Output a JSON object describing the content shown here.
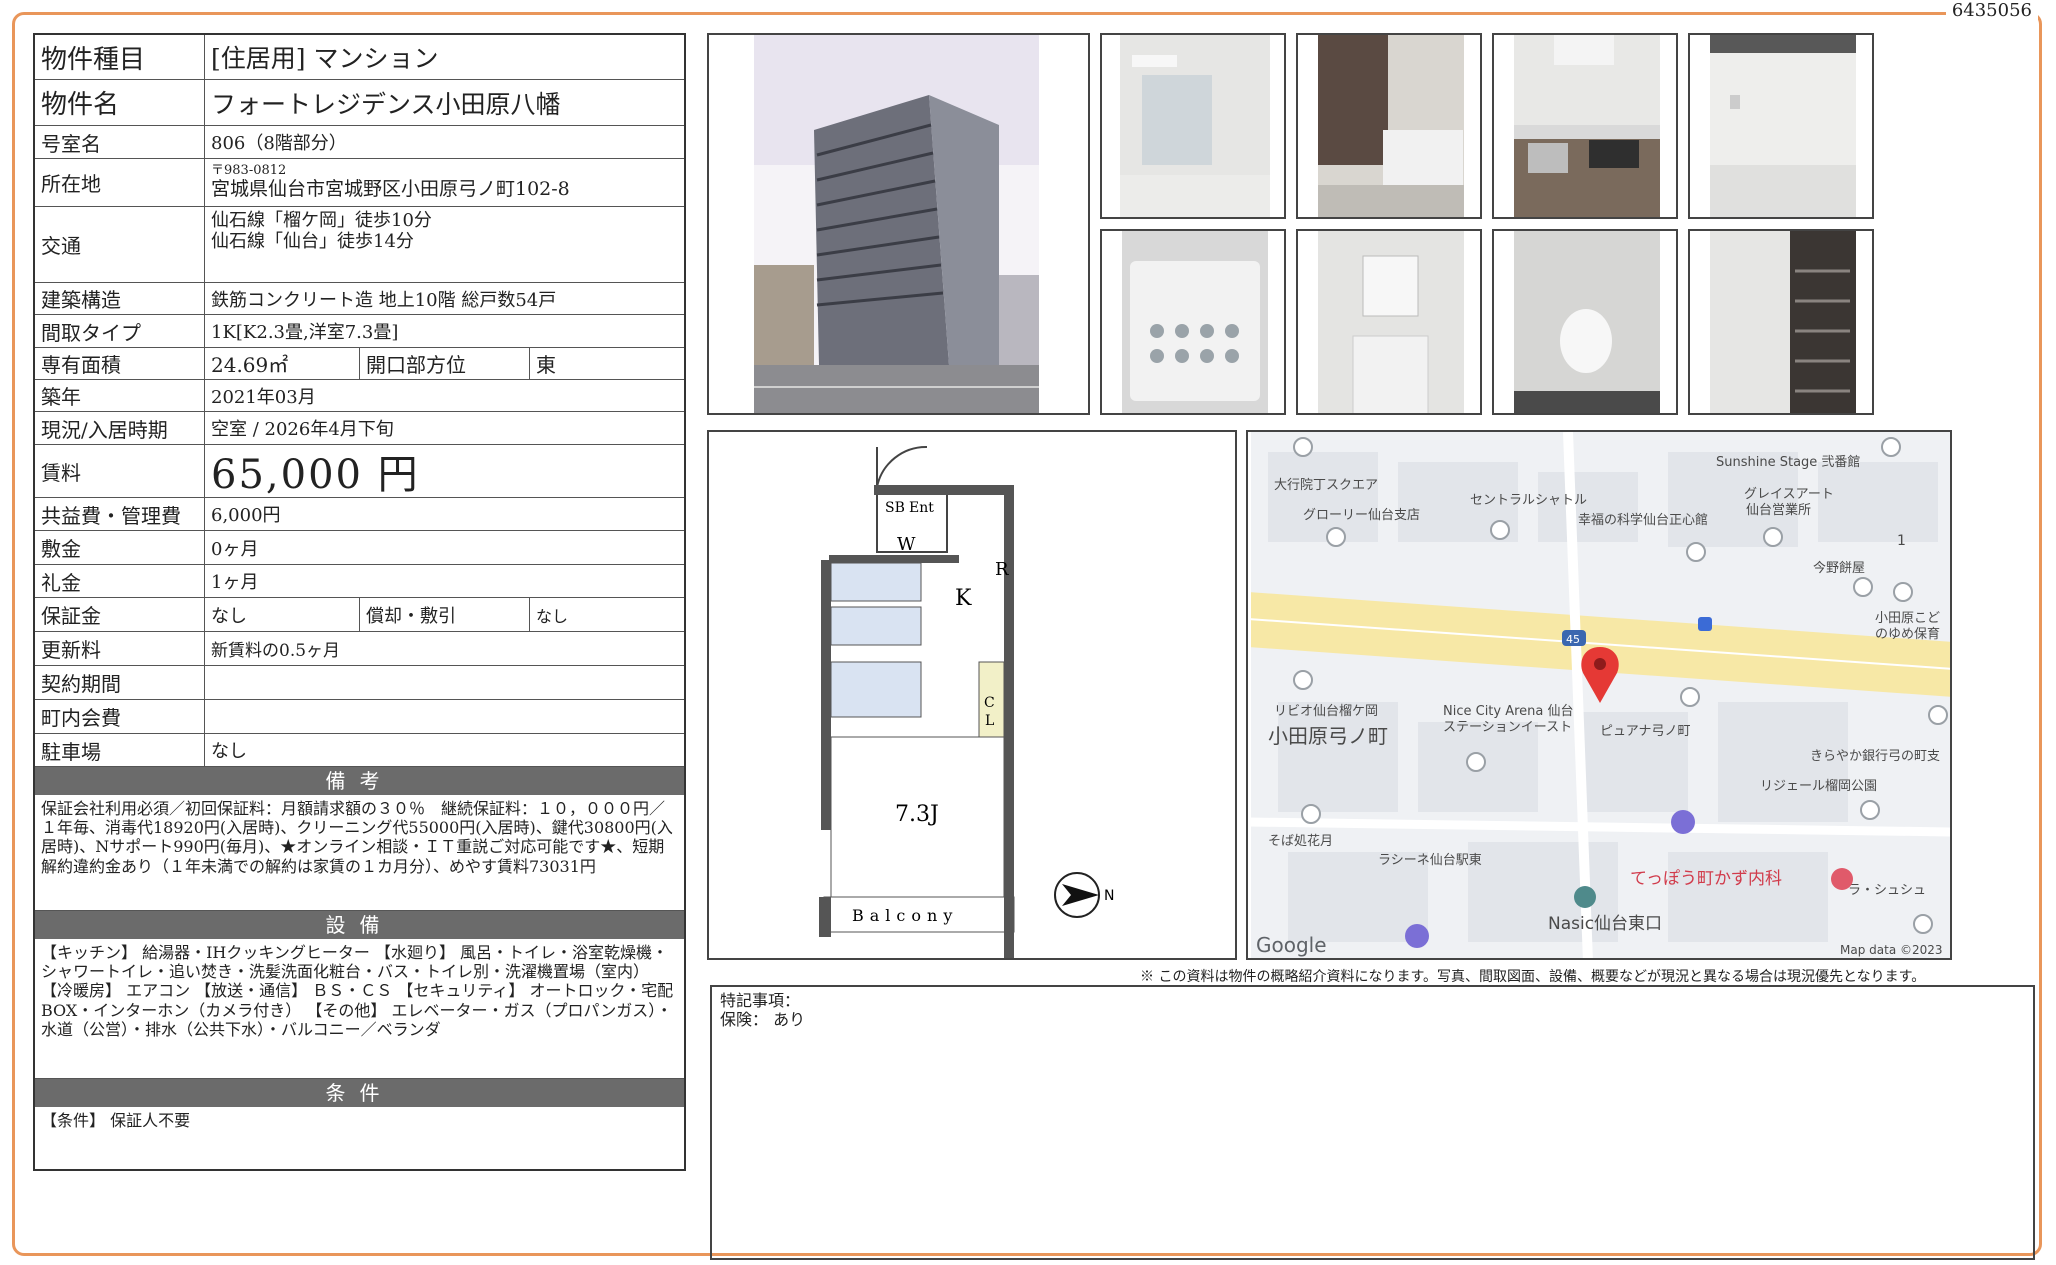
{
  "doc_id": "6435056",
  "property": {
    "type_label": "物件種目",
    "type_value": "[住居用] マンション",
    "name_label": "物件名",
    "name_value": "フォートレジデンス小田原八幡",
    "room_label": "号室名",
    "room_value": "806（8階部分）",
    "address_label": "所在地",
    "zip": "〒983-0812",
    "address": "宮城県仙台市宮城野区小田原弓ノ町102-8",
    "transport_label": "交通",
    "transport_1": "仙石線「榴ケ岡」徒歩10分",
    "transport_2": "仙石線「仙台」徒歩14分",
    "structure_label": "建築構造",
    "structure_value": "鉄筋コンクリート造 地上10階 総戸数54戸",
    "layout_label": "間取タイプ",
    "layout_value": "1K[K2.3畳,洋室7.3畳]",
    "area_label": "専有面積",
    "area_value": "24.69㎡",
    "direction_label": "開口部方位",
    "direction_value": "東",
    "built_label": "築年",
    "built_value": "2021年03月",
    "status_label": "現況/入居時期",
    "status_value": "空室 / 2026年4月下旬",
    "rent_label": "賃料",
    "rent_value": "65,000 円",
    "fee_label": "共益費・管理費",
    "fee_value": "6,000円",
    "deposit_label": "敷金",
    "deposit_value": "0ヶ月",
    "key_money_label": "礼金",
    "key_money_value": "1ヶ月",
    "guarantee_label": "保証金",
    "guarantee_value": "なし",
    "amort_label": "償却・敷引",
    "amort_value": "なし",
    "renewal_label": "更新料",
    "renewal_value": "新賃料の0.5ヶ月",
    "contract_label": "契約期間",
    "contract_value": "",
    "town_label": "町内会費",
    "town_value": "",
    "parking_label": "駐車場",
    "parking_value": "なし"
  },
  "sections": {
    "remarks_title": "備考",
    "remarks_text": "保証会社利用必須／初回保証料：月額請求額の３０％　継続保証料：１０，０００円／１年毎、消毒代18920円(入居時)、クリーニング代55000円(入居時)、鍵代30800円(入居時)、Nサポート990円(毎月)、★オンライン相談・ＩＴ重説ご対応可能です★、短期解約違約金あり（１年未満での解約は家賃の１カ月分）、めやす賃料73031円",
    "equipment_title": "設備",
    "equipment_text": "【キッチン】 給湯器・IHクッキングヒーター 【水廻り】 風呂・トイレ・浴室乾燥機・シャワートイレ・追い焚き・洗髪洗面化粧台・バス・トイレ別・洗濯機置場（室内） 【冷暖房】 エアコン 【放送・通信】 ＢＳ・ＣＳ 【セキュリティ】 オートロック・宅配BOX・インターホン（カメラ付き） 【その他】 エレベーター・ガス（プロパンガス）・水道（公営）・排水（公共下水）・バルコニー／ベランダ",
    "conditions_title": "条件",
    "conditions_text": "【条件】 保証人不要"
  },
  "floorplan": {
    "labels": [
      "SB",
      "Ent",
      "W",
      "R",
      "K",
      "C",
      "L",
      "7.3J",
      "Balcony"
    ],
    "north": "N"
  },
  "map": {
    "labels": [
      "大行院丁スクエア",
      "グローリー仙台支店",
      "セントラルシャトル",
      "幸福の科学仙台正心館",
      "Sunshine Stage 弐番館",
      "グレイスアート",
      "仙台営業所",
      "今野餅屋",
      "小田原こど",
      "のゆめ保育",
      "リビオ仙台榴ケ岡",
      "小田原弓ノ町",
      "Nice City Arena 仙台",
      "ステーションイースト",
      "ピュアナ弓ノ町",
      "きらやか銀行弓の町支",
      "リジェール榴岡公園",
      "そば処花月",
      "ラシーネ仙台駅東",
      "てっぽう町かず内科",
      "ラ・シュシュ",
      "Nasic仙台東口",
      "Google",
      "Map data ©2023",
      "45",
      "1"
    ]
  },
  "footer": {
    "note": "※ この資料は物件の概略紹介資料になります。写真、間取図面、設備、概要などが現況と異なる場合は現況優先となります。",
    "special_label": "特記事項：",
    "insurance": "保険： あり"
  }
}
